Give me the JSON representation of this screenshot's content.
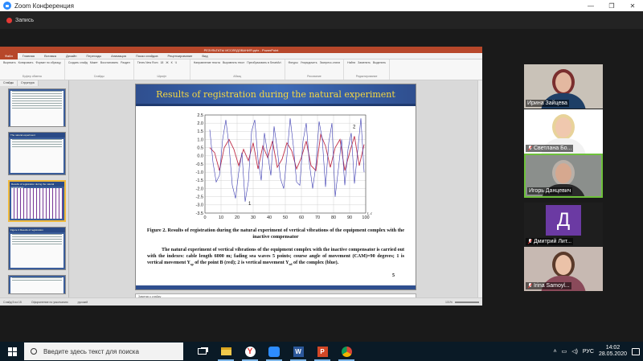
{
  "zoom": {
    "window_title": "Zoom Конференция",
    "recording_label": "Запись",
    "controls": [
      "—",
      "❐",
      "✕"
    ]
  },
  "ppt": {
    "title_bar": "РЕЗУЛЬТАТЫ ИССЛЕДОВАНИЯ.pptx - PowerPoint",
    "tabs": [
      "Файл",
      "Главная",
      "Вставка",
      "Дизайн",
      "Переходы",
      "Анимация",
      "Показ слайдов",
      "Рецензирование",
      "Вид"
    ],
    "ribbon_groups": [
      {
        "label": "Буфер обмена",
        "items": [
          "Вырезать",
          "Копировать",
          "Формат по образцу"
        ]
      },
      {
        "label": "Слайды",
        "items": [
          "Создать слайд",
          "Макет",
          "Восстановить",
          "Раздел"
        ]
      },
      {
        "label": "Шрифт",
        "items": [
          "Times New Rom",
          "18",
          "Ж",
          "К",
          "Ч"
        ]
      },
      {
        "label": "Абзац",
        "items": [
          "Направление текста",
          "Выровнять текст",
          "Преобразовать в SmartArt"
        ]
      },
      {
        "label": "Рисование",
        "items": [
          "Фигуры",
          "Упорядочить",
          "Экспресс-стили"
        ]
      },
      {
        "label": "Редактирование",
        "items": [
          "Найти",
          "Заменить",
          "Выделить"
        ]
      }
    ],
    "thumb_tabs": [
      "Слайды",
      "Структура"
    ],
    "thumbnails": [
      {
        "num": "",
        "title": ""
      },
      {
        "num": "",
        "title": "The natural experiment"
      },
      {
        "num": "",
        "title": "Results of registration during the natural experiment"
      },
      {
        "num": "",
        "title": "Figure 3 Results of registration"
      },
      {
        "num": "",
        "title": ""
      }
    ],
    "notes_placeholder": "Заметки к слайду",
    "status": {
      "slide": "Слайд 5 из 15",
      "theme": "Оформление по умолчанию",
      "lang": "русский",
      "zoom": "131%"
    }
  },
  "slide": {
    "heading": "Results of registration during the natural experiment",
    "figure_caption": "Figure 2. Results of registration during the natural experiment of vertical vibrations of the equipment complex with the inactive compensator",
    "body_parts": {
      "p1": "The natural experiment of vertical vibrations of the equipment complex with the inactive compensator is carried out with the indexes: cable length 6000 m; fading sea waves 5 points; course angle of movement (CAM)=90 degrees; 1 is vertical movement Y",
      "sub1": "sp",
      "p2": " of the point B (red); 2 is vertical movement Y",
      "sub2": "ed",
      "p3": " of the complex (blue)."
    },
    "page_number": "5"
  },
  "chart_data": {
    "type": "line",
    "title": "",
    "xlabel": "t, c",
    "ylabel": "",
    "xlim": [
      0,
      100
    ],
    "ylim": [
      -3.5,
      2.5
    ],
    "x_ticks": [
      0,
      10,
      20,
      30,
      40,
      50,
      60,
      70,
      80,
      90,
      100
    ],
    "y_ticks": [
      2.5,
      2.0,
      1.5,
      1.0,
      0.5,
      0.0,
      -0.5,
      -1.0,
      -1.5,
      -2.0,
      -2.5,
      -3.0,
      -3.5
    ],
    "y_tick_labels": [
      "2.5",
      "2.0",
      "1.5",
      "1.0",
      "0.5",
      "0.0",
      "-0.5",
      "-1.0",
      "-1.5",
      "-2.0",
      "-2.5",
      "-3.0",
      "-3.5"
    ],
    "annotations": [
      {
        "text": "1",
        "x": 27,
        "y": -3.0
      },
      {
        "text": "2",
        "x": 92,
        "y": 1.7
      }
    ],
    "series": [
      {
        "color": "#c0304a",
        "x": [
          3,
          6,
          9,
          12,
          15,
          18,
          21,
          24,
          27,
          30,
          33,
          36,
          39,
          42,
          45,
          48,
          51,
          54,
          57,
          60,
          63,
          66,
          69,
          72,
          75,
          78,
          81,
          84,
          87,
          90,
          93,
          96,
          99
        ],
        "y": [
          0.5,
          0.2,
          -0.9,
          0.5,
          1.0,
          0.4,
          -0.6,
          0.4,
          -0.3,
          0.8,
          -0.8,
          0.6,
          -0.1,
          0.9,
          -0.7,
          -0.2,
          0.8,
          0.3,
          -0.8,
          -0.1,
          0.9,
          -0.6,
          -0.9,
          1.3,
          0.6,
          -0.7,
          0.5,
          1.0,
          -0.9,
          0.2,
          1.2,
          -0.6,
          0.7
        ]
      },
      {
        "color": "#3a3ab0",
        "x": [
          3,
          5,
          7,
          9,
          11,
          13,
          15,
          17,
          19,
          21,
          23,
          25,
          27,
          29,
          31,
          33,
          35,
          37,
          39,
          41,
          43,
          45,
          47,
          49,
          51,
          53,
          55,
          57,
          59,
          61,
          63,
          65,
          67,
          69,
          71,
          73,
          75,
          77,
          79,
          81,
          83,
          85,
          87,
          89,
          91,
          93,
          95,
          97,
          99
        ],
        "y": [
          1.6,
          -0.4,
          -1.6,
          -1.2,
          1.0,
          2.2,
          0.6,
          -1.8,
          -2.6,
          -1.0,
          0.2,
          -2.8,
          -1.6,
          1.5,
          2.2,
          -0.2,
          -1.5,
          1.4,
          0.1,
          -1.2,
          1.8,
          0.4,
          -1.4,
          -2.0,
          0.0,
          2.3,
          0.6,
          -1.6,
          -1.8,
          0.9,
          2.0,
          -0.5,
          -2.0,
          -0.6,
          2.1,
          1.0,
          -1.9,
          0.8,
          2.0,
          -2.5,
          -0.8,
          1.0,
          -1.8,
          0.4,
          1.4,
          -1.7,
          0.3,
          2.3,
          -1.0
        ]
      }
    ]
  },
  "participants": [
    {
      "name": "Ирина Зайцева",
      "muted": false,
      "bg": "#c9c2b8",
      "skin": "#e3b8a0",
      "hair": "#7a2e2e",
      "top": "#1e3f66",
      "active": false
    },
    {
      "name": "Светлана Бо...",
      "muted": true,
      "bg": "#ffffff",
      "skin": "#f0c8ae",
      "hair": "#e8d39a",
      "top": "#f2f2f2",
      "active": false
    },
    {
      "name": "Игорь Данцевич",
      "muted": false,
      "bg": "#8b8f8c",
      "skin": "#d6a88f",
      "hair": "#b9b0a8",
      "top": "#2a2a2a",
      "active": true
    },
    {
      "name": "Дмитрий Лит...",
      "muted": true,
      "initial": "Д",
      "active": false
    },
    {
      "name": "Irina Samoyl...",
      "muted": true,
      "bg": "#c7b9b2",
      "skin": "#ebc2a8",
      "hair": "#5a3a2a",
      "top": "#8a4a5a",
      "active": false
    }
  ],
  "taskbar": {
    "search_placeholder": "Введите здесь текст для поиска",
    "apps": [
      "task-view-icon",
      "file-explorer-icon",
      "yandex-browser-icon",
      "zoom-icon",
      "word-icon",
      "powerpoint-icon",
      "chrome-icon"
    ],
    "lang": "РУС",
    "time": "14:02",
    "date": "28.05.2020"
  }
}
